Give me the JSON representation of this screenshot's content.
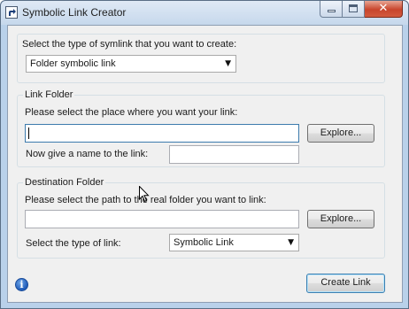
{
  "window": {
    "title": "Symbolic Link Creator"
  },
  "symlink_type": {
    "prompt": "Select the type of symlink that you want to create:",
    "selected": "Folder symbolic link"
  },
  "link_folder": {
    "group_title": "Link Folder",
    "place_prompt": "Please select the place where you want your link:",
    "place_value": "",
    "explore_label": "Explore...",
    "name_prompt": "Now give a name to the link:",
    "name_value": ""
  },
  "destination_folder": {
    "group_title": "Destination Folder",
    "path_prompt": "Please select the path to the real folder you want to link:",
    "path_value": "",
    "explore_label": "Explore...",
    "link_type_prompt": "Select the type of link:",
    "link_type_selected": "Symbolic Link"
  },
  "footer": {
    "create_label": "Create Link"
  },
  "icons": {
    "info": "info-icon",
    "app": "shortcut-arrow-icon"
  },
  "colors": {
    "titlebar": "#c6d8ec",
    "close": "#c8452c",
    "info": "#1f5bb8"
  }
}
